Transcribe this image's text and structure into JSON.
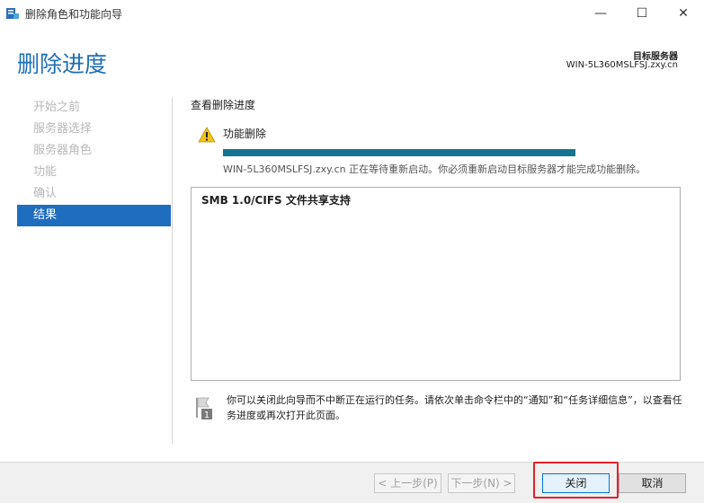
{
  "window": {
    "title": "删除角色和功能向导",
    "minimize_glyph": "—",
    "maximize_glyph": "☐",
    "close_glyph": "✕"
  },
  "header": {
    "title": "删除进度",
    "target_server_label": "目标服务器",
    "target_server_name": "WIN-5L360MSLFSJ.zxy.cn"
  },
  "sidebar": {
    "items": [
      {
        "label": "开始之前"
      },
      {
        "label": "服务器选择"
      },
      {
        "label": "服务器角色"
      },
      {
        "label": "功能"
      },
      {
        "label": "确认"
      },
      {
        "label": "结果"
      }
    ],
    "active_index": 5
  },
  "main": {
    "section_title": "查看删除进度",
    "feature_label": "功能删除",
    "progress_percent": 100,
    "status_text": "WIN-5L360MSLFSJ.zxy.cn 正在等待重新启动。你必须重新启动目标服务器才能完成功能删除。",
    "results": [
      "SMB 1.0/CIFS 文件共享支持"
    ],
    "info_text": "你可以关闭此向导而不中断正在运行的任务。请依次单击命令栏中的“通知”和“任务详细信息”，以查看任务进度或再次打开此页面。",
    "info_badge": "1"
  },
  "footer": {
    "prev_label": "< 上一步(P)",
    "next_label": "下一步(N) >",
    "close_label": "关闭",
    "cancel_label": "取消"
  },
  "colors": {
    "accent": "#1f6dbf",
    "progress": "#15748f",
    "highlight": "#e0202a"
  },
  "icons": {
    "app": "server-manager-icon",
    "warning": "warning-triangle-icon",
    "info": "flag-notification-icon"
  }
}
